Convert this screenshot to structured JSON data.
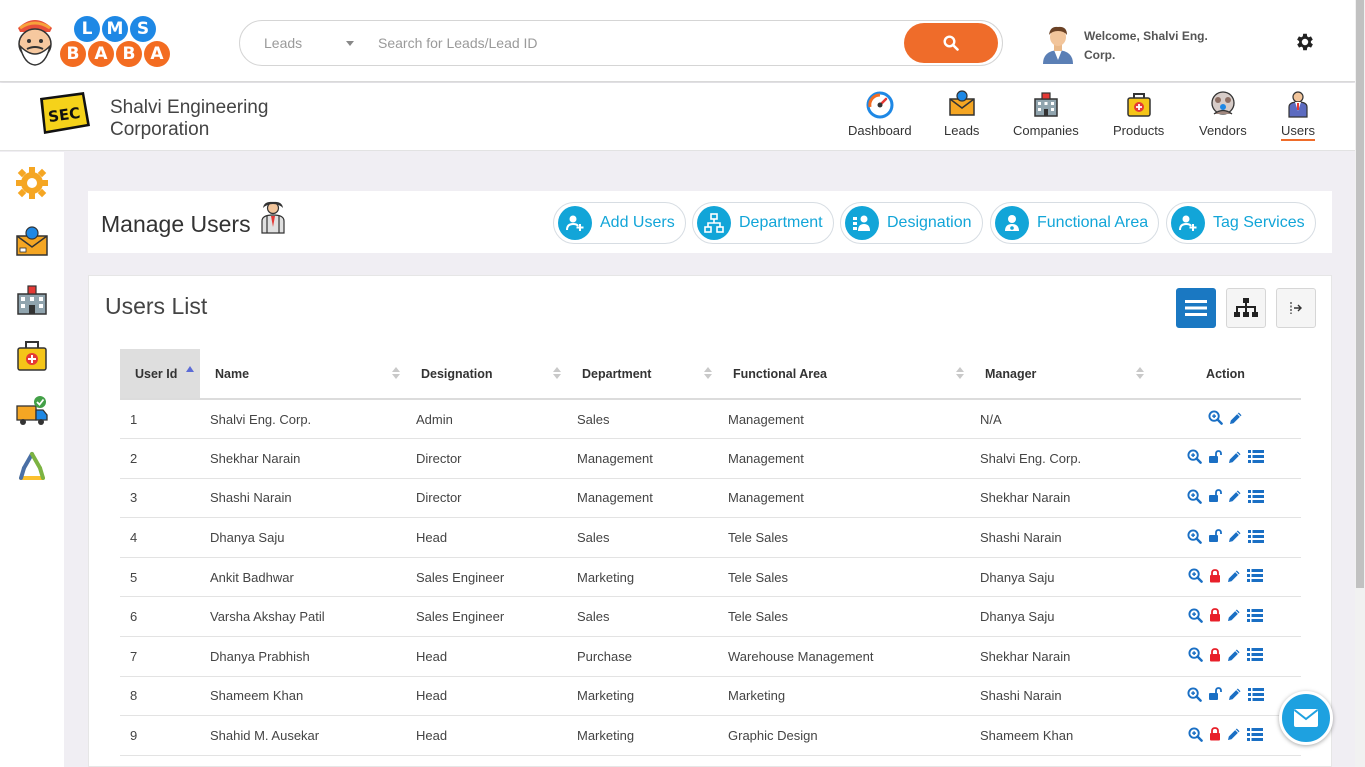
{
  "brand": {
    "logo_top_letters": [
      "L",
      "M",
      "S"
    ],
    "logo_bottom_letters": [
      "B",
      "A",
      "B",
      "A"
    ],
    "colors": {
      "blue": "#1e88e5",
      "orange": "#f36c21"
    }
  },
  "search": {
    "type_label": "Leads",
    "placeholder": "Search for Leads/Lead ID",
    "button_color": "#ef6c2a"
  },
  "user": {
    "welcome": "Welcome, Shalvi Eng. Corp."
  },
  "company": {
    "name": "Shalvi Engineering Corporation"
  },
  "nav": [
    {
      "label": "Dashboard",
      "icon": "dashboard-gauge-icon"
    },
    {
      "label": "Leads",
      "icon": "leads-envelope-icon"
    },
    {
      "label": "Companies",
      "icon": "companies-building-icon"
    },
    {
      "label": "Products",
      "icon": "products-bag-icon"
    },
    {
      "label": "Vendors",
      "icon": "vendors-people-icon"
    },
    {
      "label": "Users",
      "icon": "users-person-icon",
      "active": true
    }
  ],
  "sidebar": [
    "settings-gear-icon",
    "leads-envelope-icon",
    "companies-building-icon",
    "products-bag-icon",
    "delivery-truck-icon",
    "recycle-icon"
  ],
  "manage": {
    "title": "Manage Users",
    "actions": [
      "Add Users",
      "Department",
      "Designation",
      "Functional Area",
      "Tag Services"
    ],
    "accent": "#12a5d8"
  },
  "users_list": {
    "title": "Users List",
    "columns": [
      "User Id",
      "Name",
      "Designation",
      "Department",
      "Functional Area",
      "Manager",
      "Action"
    ],
    "rows": [
      {
        "id": "1",
        "name": "Shalvi Eng. Corp.",
        "designation": "Admin",
        "department": "Sales",
        "area": "Management",
        "manager": "N/A",
        "lock": "none"
      },
      {
        "id": "2",
        "name": "Shekhar Narain",
        "designation": "Director",
        "department": "Management",
        "area": "Management",
        "manager": "Shalvi Eng. Corp.",
        "lock": "unlocked"
      },
      {
        "id": "3",
        "name": "Shashi Narain",
        "designation": "Director",
        "department": "Management",
        "area": "Management",
        "manager": "Shekhar Narain",
        "lock": "unlocked"
      },
      {
        "id": "4",
        "name": "Dhanya Saju",
        "designation": "Head",
        "department": "Sales",
        "area": "Tele Sales",
        "manager": "Shashi Narain",
        "lock": "unlocked"
      },
      {
        "id": "5",
        "name": "Ankit Badhwar",
        "designation": "Sales Engineer",
        "department": "Marketing",
        "area": "Tele Sales",
        "manager": "Dhanya Saju",
        "lock": "locked"
      },
      {
        "id": "6",
        "name": "Varsha Akshay Patil",
        "designation": "Sales Engineer",
        "department": "Sales",
        "area": "Tele Sales",
        "manager": "Dhanya Saju",
        "lock": "locked"
      },
      {
        "id": "7",
        "name": "Dhanya Prabhish",
        "designation": "Head",
        "department": "Purchase",
        "area": "Warehouse Management",
        "manager": "Shekhar Narain",
        "lock": "locked"
      },
      {
        "id": "8",
        "name": "Shameem Khan",
        "designation": "Head",
        "department": "Marketing",
        "area": "Marketing",
        "manager": "Shashi Narain",
        "lock": "unlocked"
      },
      {
        "id": "9",
        "name": "Shahid M. Ausekar",
        "designation": "Head",
        "department": "Marketing",
        "area": "Graphic Design",
        "manager": "Shameem Khan",
        "lock": "locked"
      }
    ]
  }
}
